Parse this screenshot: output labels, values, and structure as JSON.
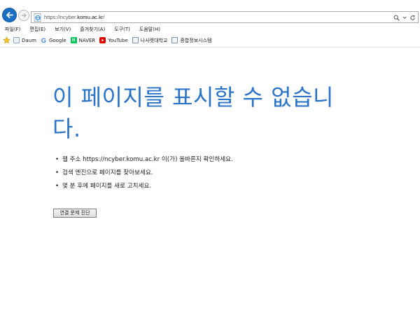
{
  "browser": {
    "address_bar": {
      "url_prefix": "https://ncyber.",
      "url_host": "komu.ac.kr",
      "url_suffix": "/"
    },
    "icons": {
      "back": "back-arrow-icon",
      "forward": "forward-arrow-icon",
      "site": "ie-page-icon",
      "search": "search-icon",
      "dropdown": "chevron-down-icon",
      "refresh": "refresh-icon"
    },
    "menu": [
      {
        "label": "파일(F)"
      },
      {
        "label": "편집(E)"
      },
      {
        "label": "보기(V)"
      },
      {
        "label": "즐겨찾기(A)"
      },
      {
        "label": "도구(T)"
      },
      {
        "label": "도움말(H)"
      }
    ],
    "favorites": [
      {
        "label": "Daum",
        "icon": "page-icon"
      },
      {
        "label": "Google",
        "icon": "google-icon"
      },
      {
        "label": "NAVER",
        "icon": "naver-icon"
      },
      {
        "label": "YouTube",
        "icon": "youtube-icon"
      },
      {
        "label": "나사렛대학교",
        "icon": "page-icon"
      },
      {
        "label": "종합정보시스템",
        "icon": "page-icon"
      }
    ]
  },
  "error_page": {
    "title": "이 페이지를 표시할 수 없습니다.",
    "suggestions": [
      "웹 주소 https://ncyber.komu.ac.kr 이(가) 올바른지 확인하세요.",
      "검색 엔진으로 페이지를 찾아보세요.",
      "몇 분 후에 페이지를 새로 고치세요."
    ],
    "diagnose_button": "연결 문제 진단"
  },
  "colors": {
    "title": "#2b73c9",
    "back_button": "#1a6fc4"
  }
}
